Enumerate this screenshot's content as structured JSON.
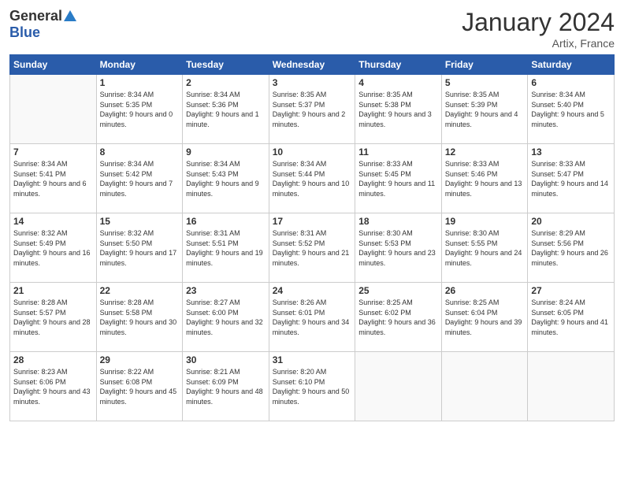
{
  "header": {
    "logo_general": "General",
    "logo_blue": "Blue",
    "title": "January 2024",
    "location": "Artix, France"
  },
  "weekdays": [
    "Sunday",
    "Monday",
    "Tuesday",
    "Wednesday",
    "Thursday",
    "Friday",
    "Saturday"
  ],
  "weeks": [
    [
      {
        "day": "",
        "sunrise": "",
        "sunset": "",
        "daylight": ""
      },
      {
        "day": "1",
        "sunrise": "Sunrise: 8:34 AM",
        "sunset": "Sunset: 5:35 PM",
        "daylight": "Daylight: 9 hours and 0 minutes."
      },
      {
        "day": "2",
        "sunrise": "Sunrise: 8:34 AM",
        "sunset": "Sunset: 5:36 PM",
        "daylight": "Daylight: 9 hours and 1 minute."
      },
      {
        "day": "3",
        "sunrise": "Sunrise: 8:35 AM",
        "sunset": "Sunset: 5:37 PM",
        "daylight": "Daylight: 9 hours and 2 minutes."
      },
      {
        "day": "4",
        "sunrise": "Sunrise: 8:35 AM",
        "sunset": "Sunset: 5:38 PM",
        "daylight": "Daylight: 9 hours and 3 minutes."
      },
      {
        "day": "5",
        "sunrise": "Sunrise: 8:35 AM",
        "sunset": "Sunset: 5:39 PM",
        "daylight": "Daylight: 9 hours and 4 minutes."
      },
      {
        "day": "6",
        "sunrise": "Sunrise: 8:34 AM",
        "sunset": "Sunset: 5:40 PM",
        "daylight": "Daylight: 9 hours and 5 minutes."
      }
    ],
    [
      {
        "day": "7",
        "sunrise": "Sunrise: 8:34 AM",
        "sunset": "Sunset: 5:41 PM",
        "daylight": "Daylight: 9 hours and 6 minutes."
      },
      {
        "day": "8",
        "sunrise": "Sunrise: 8:34 AM",
        "sunset": "Sunset: 5:42 PM",
        "daylight": "Daylight: 9 hours and 7 minutes."
      },
      {
        "day": "9",
        "sunrise": "Sunrise: 8:34 AM",
        "sunset": "Sunset: 5:43 PM",
        "daylight": "Daylight: 9 hours and 9 minutes."
      },
      {
        "day": "10",
        "sunrise": "Sunrise: 8:34 AM",
        "sunset": "Sunset: 5:44 PM",
        "daylight": "Daylight: 9 hours and 10 minutes."
      },
      {
        "day": "11",
        "sunrise": "Sunrise: 8:33 AM",
        "sunset": "Sunset: 5:45 PM",
        "daylight": "Daylight: 9 hours and 11 minutes."
      },
      {
        "day": "12",
        "sunrise": "Sunrise: 8:33 AM",
        "sunset": "Sunset: 5:46 PM",
        "daylight": "Daylight: 9 hours and 13 minutes."
      },
      {
        "day": "13",
        "sunrise": "Sunrise: 8:33 AM",
        "sunset": "Sunset: 5:47 PM",
        "daylight": "Daylight: 9 hours and 14 minutes."
      }
    ],
    [
      {
        "day": "14",
        "sunrise": "Sunrise: 8:32 AM",
        "sunset": "Sunset: 5:49 PM",
        "daylight": "Daylight: 9 hours and 16 minutes."
      },
      {
        "day": "15",
        "sunrise": "Sunrise: 8:32 AM",
        "sunset": "Sunset: 5:50 PM",
        "daylight": "Daylight: 9 hours and 17 minutes."
      },
      {
        "day": "16",
        "sunrise": "Sunrise: 8:31 AM",
        "sunset": "Sunset: 5:51 PM",
        "daylight": "Daylight: 9 hours and 19 minutes."
      },
      {
        "day": "17",
        "sunrise": "Sunrise: 8:31 AM",
        "sunset": "Sunset: 5:52 PM",
        "daylight": "Daylight: 9 hours and 21 minutes."
      },
      {
        "day": "18",
        "sunrise": "Sunrise: 8:30 AM",
        "sunset": "Sunset: 5:53 PM",
        "daylight": "Daylight: 9 hours and 23 minutes."
      },
      {
        "day": "19",
        "sunrise": "Sunrise: 8:30 AM",
        "sunset": "Sunset: 5:55 PM",
        "daylight": "Daylight: 9 hours and 24 minutes."
      },
      {
        "day": "20",
        "sunrise": "Sunrise: 8:29 AM",
        "sunset": "Sunset: 5:56 PM",
        "daylight": "Daylight: 9 hours and 26 minutes."
      }
    ],
    [
      {
        "day": "21",
        "sunrise": "Sunrise: 8:28 AM",
        "sunset": "Sunset: 5:57 PM",
        "daylight": "Daylight: 9 hours and 28 minutes."
      },
      {
        "day": "22",
        "sunrise": "Sunrise: 8:28 AM",
        "sunset": "Sunset: 5:58 PM",
        "daylight": "Daylight: 9 hours and 30 minutes."
      },
      {
        "day": "23",
        "sunrise": "Sunrise: 8:27 AM",
        "sunset": "Sunset: 6:00 PM",
        "daylight": "Daylight: 9 hours and 32 minutes."
      },
      {
        "day": "24",
        "sunrise": "Sunrise: 8:26 AM",
        "sunset": "Sunset: 6:01 PM",
        "daylight": "Daylight: 9 hours and 34 minutes."
      },
      {
        "day": "25",
        "sunrise": "Sunrise: 8:25 AM",
        "sunset": "Sunset: 6:02 PM",
        "daylight": "Daylight: 9 hours and 36 minutes."
      },
      {
        "day": "26",
        "sunrise": "Sunrise: 8:25 AM",
        "sunset": "Sunset: 6:04 PM",
        "daylight": "Daylight: 9 hours and 39 minutes."
      },
      {
        "day": "27",
        "sunrise": "Sunrise: 8:24 AM",
        "sunset": "Sunset: 6:05 PM",
        "daylight": "Daylight: 9 hours and 41 minutes."
      }
    ],
    [
      {
        "day": "28",
        "sunrise": "Sunrise: 8:23 AM",
        "sunset": "Sunset: 6:06 PM",
        "daylight": "Daylight: 9 hours and 43 minutes."
      },
      {
        "day": "29",
        "sunrise": "Sunrise: 8:22 AM",
        "sunset": "Sunset: 6:08 PM",
        "daylight": "Daylight: 9 hours and 45 minutes."
      },
      {
        "day": "30",
        "sunrise": "Sunrise: 8:21 AM",
        "sunset": "Sunset: 6:09 PM",
        "daylight": "Daylight: 9 hours and 48 minutes."
      },
      {
        "day": "31",
        "sunrise": "Sunrise: 8:20 AM",
        "sunset": "Sunset: 6:10 PM",
        "daylight": "Daylight: 9 hours and 50 minutes."
      },
      {
        "day": "",
        "sunrise": "",
        "sunset": "",
        "daylight": ""
      },
      {
        "day": "",
        "sunrise": "",
        "sunset": "",
        "daylight": ""
      },
      {
        "day": "",
        "sunrise": "",
        "sunset": "",
        "daylight": ""
      }
    ]
  ]
}
